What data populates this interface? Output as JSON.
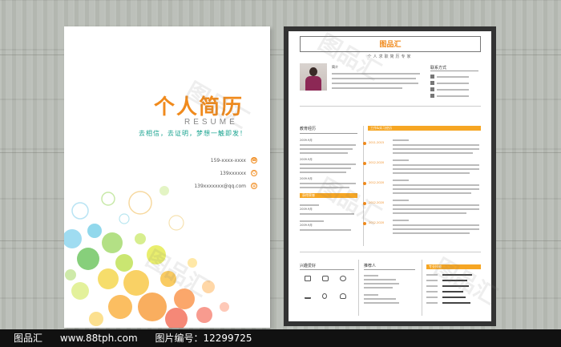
{
  "cover": {
    "title": "个人简历",
    "subtitle": "RESUME",
    "slogan": "去相信，去证明，梦想一触即发！",
    "contacts": [
      {
        "icon": "phone-icon",
        "text": "159-xxxx-xxxx"
      },
      {
        "icon": "qq-icon",
        "text": "139xxxxxx"
      },
      {
        "icon": "email-icon",
        "text": "139xxxxxxx@qq.com"
      }
    ]
  },
  "resume": {
    "brand": "图品汇",
    "tagline": "个人求职简历专家",
    "intro_name": "简介",
    "contact_heading": "联系方式",
    "education_heading": "教育经历",
    "experience_heading": "工作&实习经历",
    "awards_heading": "获得荣誉",
    "hobbies_heading": "兴趣爱好",
    "referee_heading": "推荐人",
    "skills_heading": "专业技能",
    "edu_dates": [
      "2009.9月",
      "2009.9月",
      "2009.9月"
    ],
    "work_dates": [
      "2011-2015",
      "2012-2020",
      "2012-2020",
      "2012-2020",
      "2012-2020"
    ],
    "award_dates": [
      "2009.9月",
      "2009.9月"
    ],
    "skill_levels": [
      0.85,
      0.7,
      0.75,
      0.6,
      0.65,
      0.8
    ]
  },
  "footer": {
    "brand": "图品汇",
    "url": "www.88tph.com",
    "id_label": "图片编号：",
    "id_value": "12299725"
  },
  "colors": {
    "accent": "#f08a1c",
    "teal": "#18a38f",
    "bar": "#f6a623"
  }
}
